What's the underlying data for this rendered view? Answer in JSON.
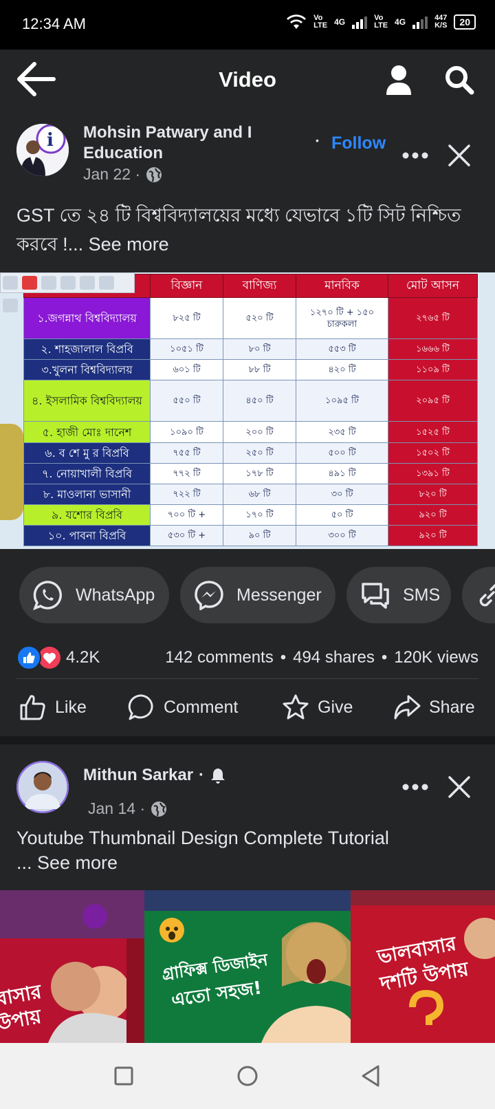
{
  "status_bar": {
    "time": "12:34 AM",
    "network1": [
      "Vo",
      "LTE"
    ],
    "gen1": "4G",
    "network2": [
      "Vo",
      "LTE"
    ],
    "gen2": "4G",
    "speed": [
      "447",
      "K/S"
    ],
    "battery": "20"
  },
  "header": {
    "title": "Video"
  },
  "post1": {
    "author": "Mohsin Patwary and I Education",
    "date": "Jan 22 ·",
    "follow_dot": "•",
    "follow_label": "Follow",
    "caption": "GST তে ২৪ টি বিশ্ববিদ্যালয়ের মধ্যে যেভাবে ১টি সিট নিশ্চিত করবে !...",
    "see_more": "See more",
    "video_table": {
      "headers": [
        "বিজ্ঞান",
        "বাণিজ্য",
        "মানবিক",
        "মোট আসন"
      ],
      "rows": [
        {
          "name": "১.জগন্নাথ বিশ্ববিদ্যালয়",
          "sci": "৮২৫ টি",
          "com": "৫২০ টি",
          "hum": "১২৭০ টি + ১৫০ চারুকলা",
          "total": "২৭৬৫ টি"
        },
        {
          "name": "২. শাহজালাল বিপ্রবি",
          "sci": "১০৫১ টি",
          "com": "৮০ টি",
          "hum": "৫৫৩ টি",
          "total": "১৬৬৬ টি"
        },
        {
          "name": "৩.খুলনা বিশ্ববিদ্যালয়",
          "sci": "৬০১ টি",
          "com": "৮৮ টি",
          "hum": "৪২০ টি",
          "total": "১১০৯ টি"
        },
        {
          "name": "৪. ইসলামিক বিশ্ববিদ্যালয়",
          "sci": "৫৫০ টি",
          "com": "৪৫০ টি",
          "hum": "১০৯৫ টি",
          "total": "২০৯৫ টি"
        },
        {
          "name": "৫. হাজী মোঃ দানেশ",
          "sci": "১০৯০ টি",
          "com": "২০০ টি",
          "hum": "২৩৫ টি",
          "total": "১৫২৫ টি"
        },
        {
          "name": "৬. ব শে মু র বিপ্রবি",
          "sci": "৭৫৫ টি",
          "com": "২৫০ টি",
          "hum": "৫০০ টি",
          "total": "১৫০২ টি"
        },
        {
          "name": "৭. নোয়াখালী বিপ্রবি",
          "sci": "৭৭২ টি",
          "com": "১৭৮ টি",
          "hum": "৪৯১ টি",
          "total": "১৩৯১ টি"
        },
        {
          "name": "৮. মাওলানা ভাসানী",
          "sci": "৭২২ টি",
          "com": "৬৮ টি",
          "hum": "৩০ টি",
          "total": "৮২০ টি"
        },
        {
          "name": "৯. যশোর বিপ্রবি",
          "sci": "৭০০ টি +",
          "com": "১৭০ টি",
          "hum": "৫০ টি",
          "total": "৯২০ টি"
        },
        {
          "name": "১০. পাবনা বিপ্রবি",
          "sci": "৫৩০ টি +",
          "com": "৯০ টি",
          "hum": "৩০০ টি",
          "total": "৯২০ টি"
        }
      ]
    },
    "share_targets": [
      "WhatsApp",
      "Messenger",
      "SMS"
    ],
    "reactions_count": "4.2K",
    "comments": "142 comments",
    "shares": "494 shares",
    "views": "120K views",
    "sep": "•",
    "actions": {
      "like": "Like",
      "comment": "Comment",
      "give": "Give",
      "share": "Share"
    }
  },
  "post2": {
    "author": "Mithun Sarkar",
    "sep": "·",
    "date": "Jan 14 ·",
    "caption": "Youtube Thumbnail Design Complete Tutorial",
    "see_more": "... See more",
    "thumb_texts": [
      "বাসার উপায়",
      "গ্রাফিক্স ডিজাইন এতো সহজ!",
      "ভালবাসার দশটি উপায়"
    ]
  },
  "colors": {
    "background": "#18191a",
    "card": "#242526",
    "accent": "#2d88ff",
    "pill": "#3a3b3c",
    "table_header": "#c8102e"
  }
}
